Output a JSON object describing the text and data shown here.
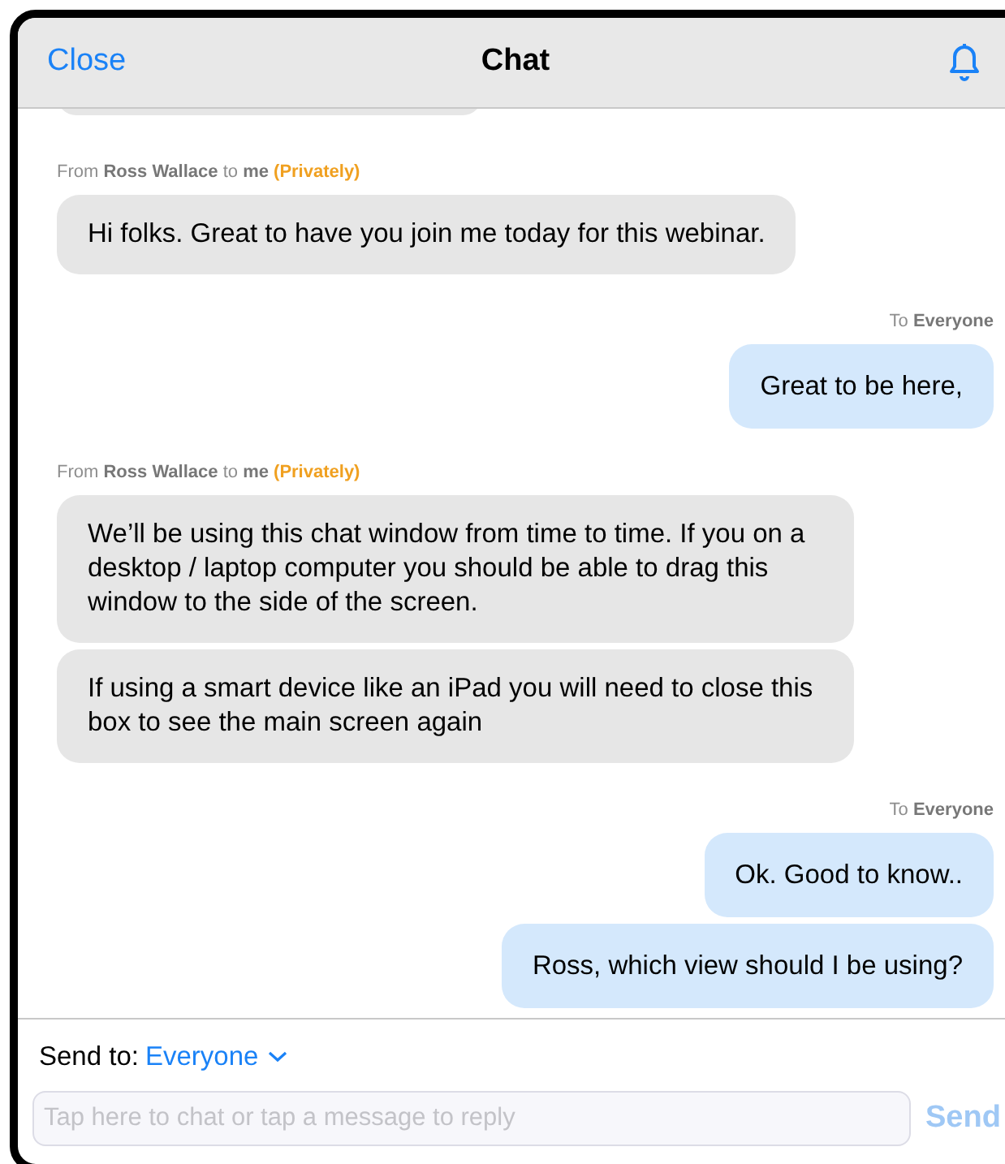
{
  "header": {
    "close": "Close",
    "title": "Chat"
  },
  "groups": [
    {
      "kind": "partial"
    },
    {
      "kind": "incoming",
      "from_word": "From",
      "sender": "Ross Wallace",
      "to_word": "to",
      "recipient": "me",
      "note": "(Privately)",
      "messages": [
        "Hi folks. Great to have you join me today for this webinar."
      ]
    },
    {
      "kind": "outgoing",
      "to_word": "To",
      "recipient": "Everyone",
      "messages": [
        "Great to be here,"
      ]
    },
    {
      "kind": "incoming",
      "from_word": "From",
      "sender": "Ross Wallace",
      "to_word": "to",
      "recipient": "me",
      "note": "(Privately)",
      "messages": [
        "We’ll be using this chat window from time to time. If you on a desktop / laptop computer you should be able to drag this window to the side of the screen.",
        "If using a smart device like an iPad you will need to close this box to see the main screen again"
      ]
    },
    {
      "kind": "outgoing",
      "to_word": "To",
      "recipient": "Everyone",
      "messages": [
        "Ok. Good to know..",
        "Ross, which view should I be using?"
      ]
    }
  ],
  "footer": {
    "send_to_label": "Send to:",
    "send_to_value": "Everyone",
    "input": {
      "placeholder": "Tap here to chat or tap a message to reply"
    },
    "send": "Send",
    "send_disabled": true
  }
}
